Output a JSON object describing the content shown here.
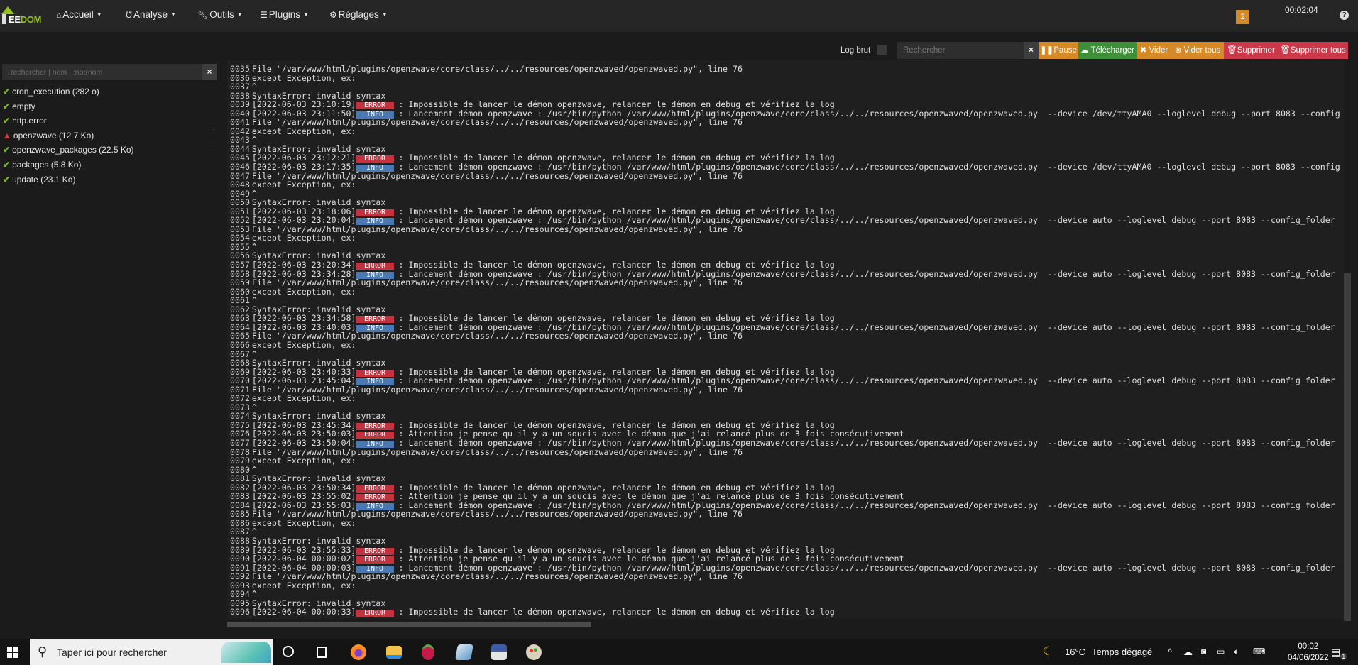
{
  "navbar": {
    "logo_text_a": "EE",
    "logo_text_b": "DOM",
    "items": [
      {
        "label": "Accueil",
        "icon": "home-icon"
      },
      {
        "label": "Analyse",
        "icon": "stethoscope-icon"
      },
      {
        "label": "Outils",
        "icon": "wrench-icon"
      },
      {
        "label": "Plugins",
        "icon": "list-icon"
      },
      {
        "label": "Réglages",
        "icon": "gear-icon"
      }
    ],
    "notification_count": "2",
    "time": "00:02:04",
    "help": "?"
  },
  "toolbar": {
    "log_brut_label": "Log brut",
    "search_placeholder": "Rechercher",
    "clear": "×",
    "pause": "Pause",
    "download": "Télécharger",
    "empty": "Vider",
    "empty_all": "Vider tous",
    "delete": "Supprimer",
    "delete_all": "Supprimer tous",
    "colors": {
      "warning": "#d58a27",
      "success": "#3f8f3a",
      "danger": "#c9394a"
    }
  },
  "sidebar": {
    "search_placeholder": "Rechercher | nom | :not(nom",
    "clear": "×",
    "files": [
      {
        "label": "cron_execution (282 o)",
        "status": "ok"
      },
      {
        "label": "empty",
        "status": "ok"
      },
      {
        "label": "http.error",
        "status": "ok"
      },
      {
        "label": "openzwave (12.7 Ko)",
        "status": "warning",
        "active": true
      },
      {
        "label": "openzwave_packages (22.5 Ko)",
        "status": "ok"
      },
      {
        "label": "packages (5.8 Ko)",
        "status": "ok"
      },
      {
        "label": "update (23.1 Ko)",
        "status": "ok"
      }
    ]
  },
  "log": {
    "lines": [
      {
        "n": "0035",
        "msg": "File \"/var/www/html/plugins/openzwave/core/class/../../resources/openzwaved/openzwaved.py\", line 76"
      },
      {
        "n": "0036",
        "msg": "except Exception, ex:"
      },
      {
        "n": "0037",
        "msg": "^"
      },
      {
        "n": "0038",
        "msg": "SyntaxError: invalid syntax"
      },
      {
        "n": "0039",
        "ts": "[2022-06-03 23:10:19]",
        "level": "ERROR",
        "msg": " : Impossible de lancer le démon openzwave, relancer le démon en debug et vérifiez la log"
      },
      {
        "n": "0040",
        "ts": "[2022-06-03 23:11:50]",
        "level": "INFO",
        "msg": " : Lancement démon openzwave : /usr/bin/python /var/www/html/plugins/openzwave/core/class/../../resources/openzwaved/openzwaved.py  --device /dev/ttyAMA0 --loglevel debug --port 8083 --config"
      },
      {
        "n": "0041",
        "msg": "File \"/var/www/html/plugins/openzwave/core/class/../../resources/openzwaved/openzwaved.py\", line 76"
      },
      {
        "n": "0042",
        "msg": "except Exception, ex:"
      },
      {
        "n": "0043",
        "msg": "^"
      },
      {
        "n": "0044",
        "msg": "SyntaxError: invalid syntax"
      },
      {
        "n": "0045",
        "ts": "[2022-06-03 23:12:21]",
        "level": "ERROR",
        "msg": " : Impossible de lancer le démon openzwave, relancer le démon en debug et vérifiez la log"
      },
      {
        "n": "0046",
        "ts": "[2022-06-03 23:17:35]",
        "level": "INFO",
        "msg": " : Lancement démon openzwave : /usr/bin/python /var/www/html/plugins/openzwave/core/class/../../resources/openzwaved/openzwaved.py  --device /dev/ttyAMA0 --loglevel debug --port 8083 --config"
      },
      {
        "n": "0047",
        "msg": "File \"/var/www/html/plugins/openzwave/core/class/../../resources/openzwaved/openzwaved.py\", line 76"
      },
      {
        "n": "0048",
        "msg": "except Exception, ex:"
      },
      {
        "n": "0049",
        "msg": "^"
      },
      {
        "n": "0050",
        "msg": "SyntaxError: invalid syntax"
      },
      {
        "n": "0051",
        "ts": "[2022-06-03 23:18:06]",
        "level": "ERROR",
        "msg": " : Impossible de lancer le démon openzwave, relancer le démon en debug et vérifiez la log"
      },
      {
        "n": "0052",
        "ts": "[2022-06-03 23:20:04]",
        "level": "INFO",
        "msg": " : Lancement démon openzwave : /usr/bin/python /var/www/html/plugins/openzwave/core/class/../../resources/openzwaved/openzwaved.py  --device auto --loglevel debug --port 8083 --config_folder"
      },
      {
        "n": "0053",
        "msg": "File \"/var/www/html/plugins/openzwave/core/class/../../resources/openzwaved/openzwaved.py\", line 76"
      },
      {
        "n": "0054",
        "msg": "except Exception, ex:"
      },
      {
        "n": "0055",
        "msg": "^"
      },
      {
        "n": "0056",
        "msg": "SyntaxError: invalid syntax"
      },
      {
        "n": "0057",
        "ts": "[2022-06-03 23:20:34]",
        "level": "ERROR",
        "msg": " : Impossible de lancer le démon openzwave, relancer le démon en debug et vérifiez la log"
      },
      {
        "n": "0058",
        "ts": "[2022-06-03 23:34:28]",
        "level": "INFO",
        "msg": " : Lancement démon openzwave : /usr/bin/python /var/www/html/plugins/openzwave/core/class/../../resources/openzwaved/openzwaved.py  --device auto --loglevel debug --port 8083 --config_folder"
      },
      {
        "n": "0059",
        "msg": "File \"/var/www/html/plugins/openzwave/core/class/../../resources/openzwaved/openzwaved.py\", line 76"
      },
      {
        "n": "0060",
        "msg": "except Exception, ex:"
      },
      {
        "n": "0061",
        "msg": "^"
      },
      {
        "n": "0062",
        "msg": "SyntaxError: invalid syntax"
      },
      {
        "n": "0063",
        "ts": "[2022-06-03 23:34:58]",
        "level": "ERROR",
        "msg": " : Impossible de lancer le démon openzwave, relancer le démon en debug et vérifiez la log"
      },
      {
        "n": "0064",
        "ts": "[2022-06-03 23:40:03]",
        "level": "INFO",
        "msg": " : Lancement démon openzwave : /usr/bin/python /var/www/html/plugins/openzwave/core/class/../../resources/openzwaved/openzwaved.py  --device auto --loglevel debug --port 8083 --config_folder"
      },
      {
        "n": "0065",
        "msg": "File \"/var/www/html/plugins/openzwave/core/class/../../resources/openzwaved/openzwaved.py\", line 76"
      },
      {
        "n": "0066",
        "msg": "except Exception, ex:"
      },
      {
        "n": "0067",
        "msg": "^"
      },
      {
        "n": "0068",
        "msg": "SyntaxError: invalid syntax"
      },
      {
        "n": "0069",
        "ts": "[2022-06-03 23:40:33]",
        "level": "ERROR",
        "msg": " : Impossible de lancer le démon openzwave, relancer le démon en debug et vérifiez la log"
      },
      {
        "n": "0070",
        "ts": "[2022-06-03 23:45:04]",
        "level": "INFO",
        "msg": " : Lancement démon openzwave : /usr/bin/python /var/www/html/plugins/openzwave/core/class/../../resources/openzwaved/openzwaved.py  --device auto --loglevel debug --port 8083 --config_folder"
      },
      {
        "n": "0071",
        "msg": "File \"/var/www/html/plugins/openzwave/core/class/../../resources/openzwaved/openzwaved.py\", line 76"
      },
      {
        "n": "0072",
        "msg": "except Exception, ex:"
      },
      {
        "n": "0073",
        "msg": "^"
      },
      {
        "n": "0074",
        "msg": "SyntaxError: invalid syntax"
      },
      {
        "n": "0075",
        "ts": "[2022-06-03 23:45:34]",
        "level": "ERROR",
        "msg": " : Impossible de lancer le démon openzwave, relancer le démon en debug et vérifiez la log"
      },
      {
        "n": "0076",
        "ts": "[2022-06-03 23:50:03]",
        "level": "ERROR",
        "msg": " : Attention je pense qu'il y a un soucis avec le démon que j'ai relancé plus de 3 fois consécutivement"
      },
      {
        "n": "0077",
        "ts": "[2022-06-03 23:50:04]",
        "level": "INFO",
        "msg": " : Lancement démon openzwave : /usr/bin/python /var/www/html/plugins/openzwave/core/class/../../resources/openzwaved/openzwaved.py  --device auto --loglevel debug --port 8083 --config_folder"
      },
      {
        "n": "0078",
        "msg": "File \"/var/www/html/plugins/openzwave/core/class/../../resources/openzwaved/openzwaved.py\", line 76"
      },
      {
        "n": "0079",
        "msg": "except Exception, ex:"
      },
      {
        "n": "0080",
        "msg": "^"
      },
      {
        "n": "0081",
        "msg": "SyntaxError: invalid syntax"
      },
      {
        "n": "0082",
        "ts": "[2022-06-03 23:50:34]",
        "level": "ERROR",
        "msg": " : Impossible de lancer le démon openzwave, relancer le démon en debug et vérifiez la log"
      },
      {
        "n": "0083",
        "ts": "[2022-06-03 23:55:02]",
        "level": "ERROR",
        "msg": " : Attention je pense qu'il y a un soucis avec le démon que j'ai relancé plus de 3 fois consécutivement"
      },
      {
        "n": "0084",
        "ts": "[2022-06-03 23:55:03]",
        "level": "INFO",
        "msg": " : Lancement démon openzwave : /usr/bin/python /var/www/html/plugins/openzwave/core/class/../../resources/openzwaved/openzwaved.py  --device auto --loglevel debug --port 8083 --config_folder"
      },
      {
        "n": "0085",
        "msg": "File \"/var/www/html/plugins/openzwave/core/class/../../resources/openzwaved/openzwaved.py\", line 76"
      },
      {
        "n": "0086",
        "msg": "except Exception, ex:"
      },
      {
        "n": "0087",
        "msg": "^"
      },
      {
        "n": "0088",
        "msg": "SyntaxError: invalid syntax"
      },
      {
        "n": "0089",
        "ts": "[2022-06-03 23:55:33]",
        "level": "ERROR",
        "msg": " : Impossible de lancer le démon openzwave, relancer le démon en debug et vérifiez la log"
      },
      {
        "n": "0090",
        "ts": "[2022-06-04 00:00:02]",
        "level": "ERROR",
        "msg": " : Attention je pense qu'il y a un soucis avec le démon que j'ai relancé plus de 3 fois consécutivement"
      },
      {
        "n": "0091",
        "ts": "[2022-06-04 00:00:03]",
        "level": "INFO",
        "msg": " : Lancement démon openzwave : /usr/bin/python /var/www/html/plugins/openzwave/core/class/../../resources/openzwaved/openzwaved.py  --device auto --loglevel debug --port 8083 --config_folder"
      },
      {
        "n": "0092",
        "msg": "File \"/var/www/html/plugins/openzwave/core/class/../../resources/openzwaved/openzwaved.py\", line 76"
      },
      {
        "n": "0093",
        "msg": "except Exception, ex:"
      },
      {
        "n": "0094",
        "msg": "^"
      },
      {
        "n": "0095",
        "msg": "SyntaxError: invalid syntax"
      },
      {
        "n": "0096",
        "ts": "[2022-06-04 00:00:33]",
        "level": "ERROR",
        "msg": " : Impossible de lancer le démon openzwave, relancer le démon en debug et vérifiez la log"
      }
    ]
  },
  "taskbar": {
    "search_placeholder": "Taper ici pour rechercher",
    "weather_temp": "16°C",
    "weather_text": "Temps dégagé",
    "clock_time": "00:02",
    "clock_date": "04/06/2022",
    "notifications": "1"
  }
}
